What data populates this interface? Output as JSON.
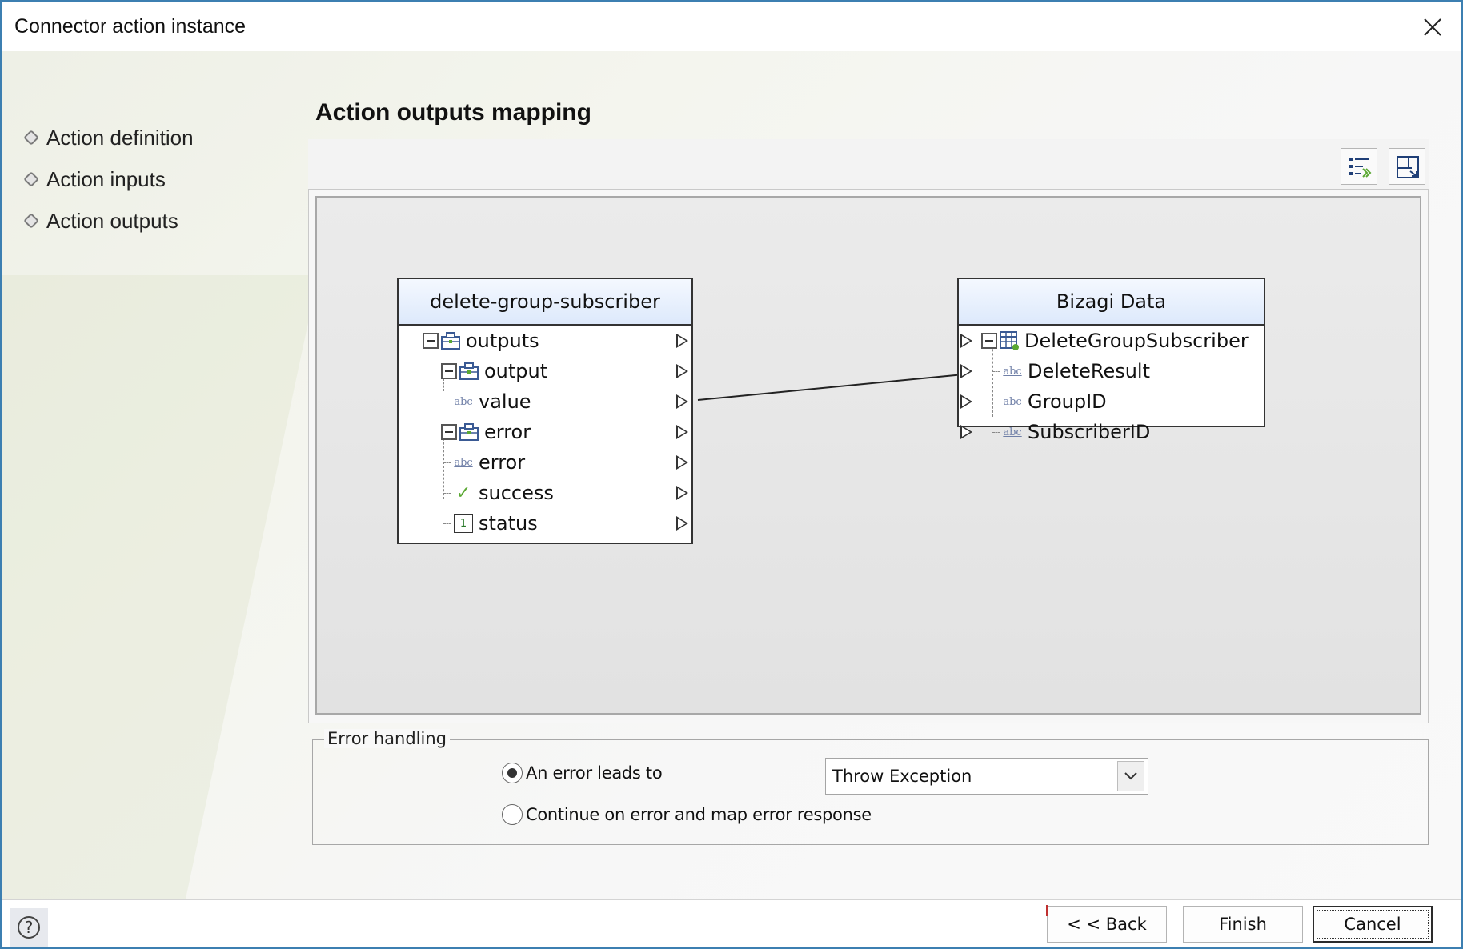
{
  "window": {
    "title": "Connector action instance"
  },
  "nav": {
    "items": [
      {
        "label": "Action definition"
      },
      {
        "label": "Action inputs"
      },
      {
        "label": "Action outputs"
      }
    ]
  },
  "main": {
    "section_title": "Action outputs mapping"
  },
  "mapping": {
    "source": {
      "title": "delete-group-subscriber",
      "rows": [
        {
          "label": "outputs",
          "icon": "object-icon"
        },
        {
          "label": "output",
          "icon": "object-icon"
        },
        {
          "label": "value",
          "icon": "string-icon"
        },
        {
          "label": "error",
          "icon": "object-icon"
        },
        {
          "label": "error",
          "icon": "string-icon"
        },
        {
          "label": "success",
          "icon": "boolean-icon"
        },
        {
          "label": "status",
          "icon": "number-icon"
        }
      ]
    },
    "target": {
      "title": "Bizagi Data",
      "rows": [
        {
          "label": "DeleteGroupSubscriber",
          "icon": "entity-icon"
        },
        {
          "label": "DeleteResult",
          "icon": "string-icon"
        },
        {
          "label": "GroupID",
          "icon": "string-icon"
        },
        {
          "label": "SubscriberID",
          "icon": "string-icon"
        }
      ]
    },
    "connections": [
      {
        "from": "value",
        "to": "DeleteResult"
      }
    ]
  },
  "error_handling": {
    "legend": "Error handling",
    "option_error_leads_to": "An error leads to",
    "option_continue": "Continue on error and map error response",
    "selected_option": "An error leads to",
    "select_value": "Throw Exception"
  },
  "footer": {
    "help_icon": "?",
    "back_label": "< < Back",
    "finish_label": "Finish",
    "cancel_label": "Cancel"
  }
}
